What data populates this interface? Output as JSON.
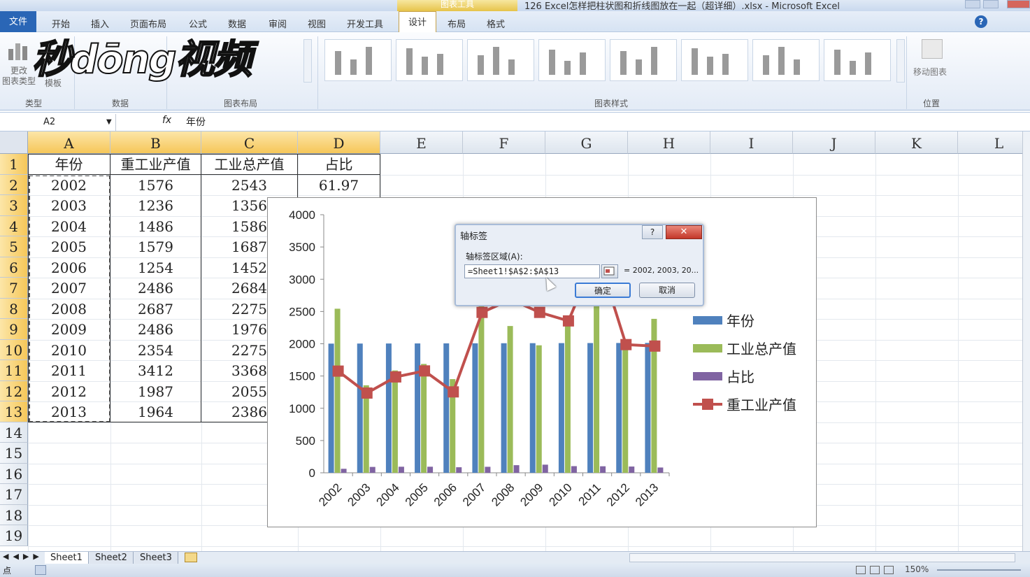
{
  "window": {
    "title": "126 Excel怎样把柱状图和折线图放在一起（超详细）.xlsx - Microsoft Excel",
    "context_tab": "图表工具"
  },
  "menu_tabs": [
    "文件",
    "开始",
    "插入",
    "页面布局",
    "公式",
    "数据",
    "审阅",
    "视图",
    "开发工具",
    "设计",
    "布局",
    "格式"
  ],
  "ribbon": {
    "change_type_label": "更改\n图表类型",
    "template_label": "模板",
    "move_chart_label": "移动图表",
    "groups": [
      "类型",
      "数据",
      "图表布局",
      "图表样式",
      "位置"
    ]
  },
  "watermark": "秒dōng视频",
  "formula_bar": {
    "name_box": "A2",
    "fx": "fx",
    "formula": "年份"
  },
  "columns": [
    "A",
    "B",
    "C",
    "D",
    "E",
    "F",
    "G",
    "H",
    "I",
    "J",
    "K",
    "L"
  ],
  "rows": [
    "1",
    "2",
    "3",
    "4",
    "5",
    "6",
    "7",
    "8",
    "9",
    "10",
    "11",
    "12",
    "13",
    "14",
    "15",
    "16",
    "17",
    "18",
    "19"
  ],
  "table": {
    "headers": [
      "年份",
      "重工业产值",
      "工业总产值",
      "占比"
    ],
    "rows": [
      [
        "2002",
        "1576",
        "2543",
        "61.97"
      ],
      [
        "2003",
        "1236",
        "1356",
        ""
      ],
      [
        "2004",
        "1486",
        "1586",
        ""
      ],
      [
        "2005",
        "1579",
        "1687",
        ""
      ],
      [
        "2006",
        "1254",
        "1452",
        ""
      ],
      [
        "2007",
        "2486",
        "2684",
        ""
      ],
      [
        "2008",
        "2687",
        "2275",
        ""
      ],
      [
        "2009",
        "2486",
        "1976",
        ""
      ],
      [
        "2010",
        "2354",
        "2275",
        ""
      ],
      [
        "2011",
        "3412",
        "3368",
        ""
      ],
      [
        "2012",
        "1987",
        "2055",
        ""
      ],
      [
        "2013",
        "1964",
        "2386",
        ""
      ]
    ]
  },
  "chart_data": {
    "type": "bar",
    "categories": [
      "2002",
      "2003",
      "2004",
      "2005",
      "2006",
      "2007",
      "2008",
      "2009",
      "2010",
      "2011",
      "2012",
      "2013"
    ],
    "ylim": [
      0,
      4000
    ],
    "yticks": [
      0,
      500,
      1000,
      1500,
      2000,
      2500,
      3000,
      3500,
      4000
    ],
    "series": [
      {
        "name": "年份",
        "kind": "bar",
        "color": "#4f81bd",
        "values": [
          2002,
          2003,
          2004,
          2005,
          2006,
          2007,
          2008,
          2009,
          2010,
          2011,
          2012,
          2013
        ]
      },
      {
        "name": "工业总产值",
        "kind": "bar",
        "color": "#9bbb59",
        "values": [
          2543,
          1356,
          1586,
          1687,
          1452,
          2684,
          2275,
          1976,
          2275,
          3368,
          2055,
          2386
        ]
      },
      {
        "name": "占比",
        "kind": "bar",
        "color": "#8064a2",
        "values": [
          62,
          91,
          94,
          94,
          86,
          93,
          118,
          126,
          103,
          101,
          97,
          82
        ]
      },
      {
        "name": "重工业产值",
        "kind": "line",
        "color": "#c0504d",
        "values": [
          1576,
          1236,
          1486,
          1579,
          1254,
          2486,
          2687,
          2486,
          2354,
          3412,
          1987,
          1964
        ]
      }
    ],
    "legend": "right"
  },
  "dialog": {
    "title": "轴标签",
    "help": "?",
    "close": "✕",
    "field_label": "轴标签区域(A):",
    "field_value": "=Sheet1!$A$2:$A$13",
    "preview": "= 2002, 2003, 20...",
    "ok": "确定",
    "cancel": "取消"
  },
  "sheets": [
    "Sheet1",
    "Sheet2",
    "Sheet3"
  ],
  "status": {
    "mode": "点",
    "zoom": "150%"
  }
}
